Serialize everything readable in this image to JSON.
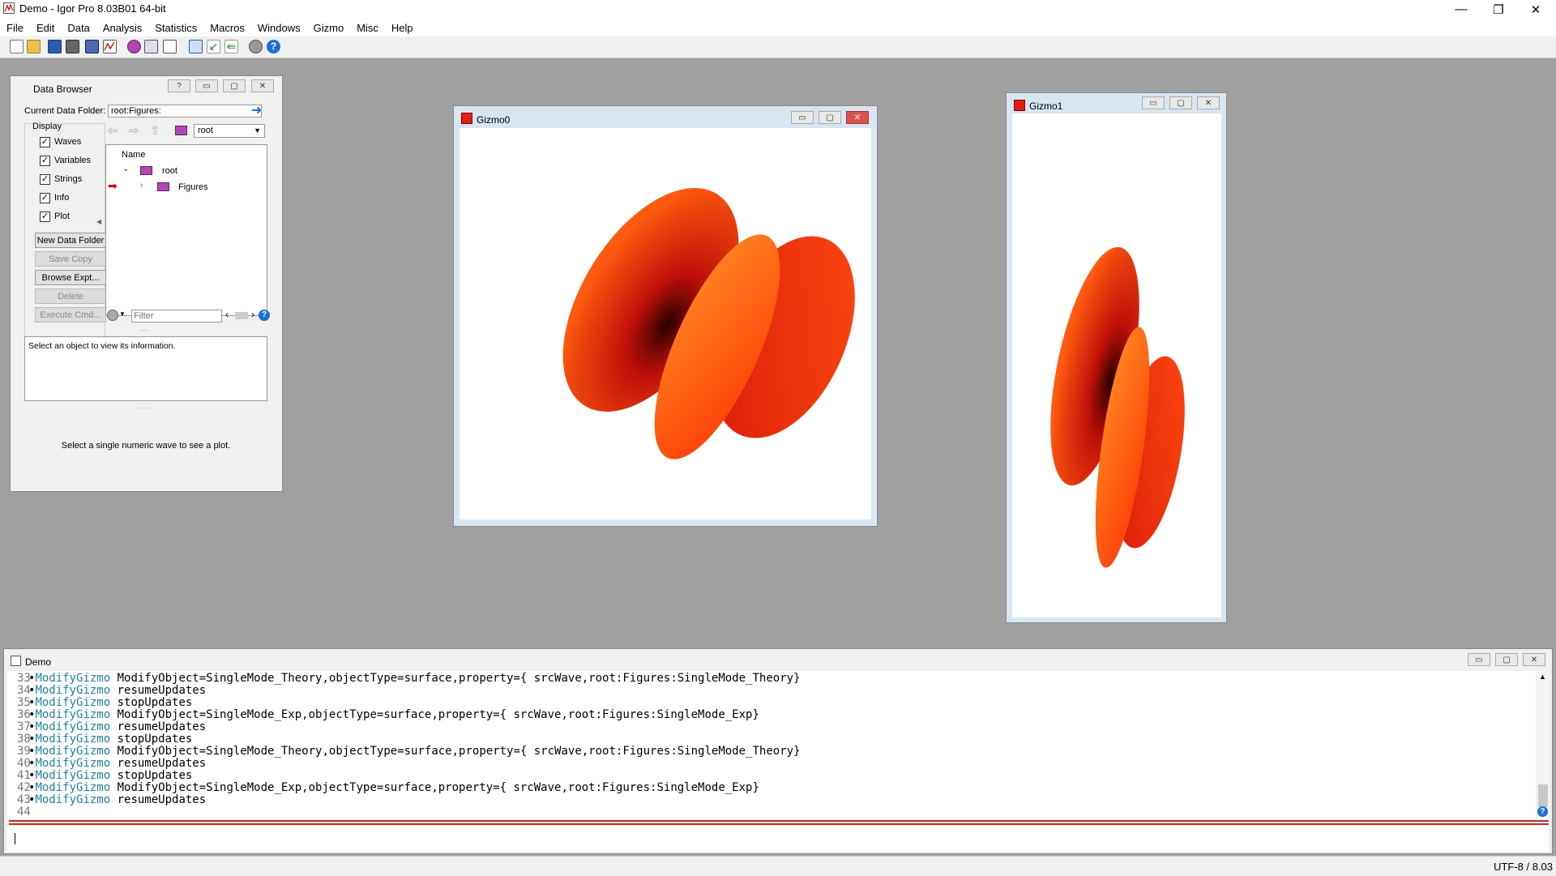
{
  "app": {
    "title": "Demo - Igor Pro 8.03B01 64-bit",
    "controls": {
      "minimize": "—",
      "restore": "❐",
      "close": "✕"
    }
  },
  "menu": [
    "File",
    "Edit",
    "Data",
    "Analysis",
    "Statistics",
    "Macros",
    "Windows",
    "Gizmo",
    "Misc",
    "Help"
  ],
  "toolbar": {
    "icons": [
      "new-file-icon",
      "open-folder-icon",
      "save-icon",
      "print-icon",
      "save-all-icon",
      "graph-icon",
      "gizmo-icon",
      "table-icon",
      "layout-icon",
      "export-icon",
      "import-icon",
      "load-icon",
      "settings-gear-icon",
      "help-icon"
    ]
  },
  "data_browser": {
    "title": "Data Browser",
    "controls": {
      "help": "?",
      "minimize": "▭",
      "restore": "▢",
      "close": "✕"
    },
    "current_folder_label": "Current Data Folder:",
    "current_folder_value": "root:Figures:",
    "display_label": "Display",
    "display_options": [
      {
        "label": "Waves",
        "checked": true
      },
      {
        "label": "Variables",
        "checked": true
      },
      {
        "label": "Strings",
        "checked": true
      },
      {
        "label": "Info",
        "checked": true
      },
      {
        "label": "Plot",
        "checked": true
      }
    ],
    "buttons": [
      {
        "label": "New Data Folder",
        "enabled": true
      },
      {
        "label": "Save Copy",
        "enabled": false
      },
      {
        "label": "Browse Expt...",
        "enabled": true
      },
      {
        "label": "Delete",
        "enabled": false
      },
      {
        "label": "Execute Cmd...",
        "enabled": false
      }
    ],
    "folder_select": "root",
    "tree_header": "Name",
    "tree": [
      {
        "label": "root",
        "expanded": true
      },
      {
        "label": "Figures",
        "expanded": false,
        "current": true
      }
    ],
    "filter_placeholder": "Filter",
    "info_text": "Select an object to view its information.",
    "plot_text": "Select a single numeric wave to see a plot."
  },
  "gizmo0": {
    "title": "Gizmo0",
    "controls": {
      "minimize": "▭",
      "restore": "▢",
      "close": "✕"
    }
  },
  "gizmo1": {
    "title": "Gizmo1",
    "controls": {
      "minimize": "▭",
      "restore": "▢",
      "close": "✕"
    }
  },
  "surface_colors": {
    "dark": "#3a0000",
    "mid": "#e02010",
    "light": "#ff7a10"
  },
  "console": {
    "title": "Demo",
    "controls": {
      "minimize": "▭",
      "restore": "▢",
      "close": "✕"
    },
    "lines": [
      {
        "num": "33",
        "cmd": "ModifyGizmo",
        "args": "ModifyObject=SingleMode_Theory,objectType=surface,property={ srcWave,root:Figures:SingleMode_Theory}"
      },
      {
        "num": "34",
        "cmd": "ModifyGizmo",
        "args": "resumeUpdates"
      },
      {
        "num": "35",
        "cmd": "ModifyGizmo",
        "args": "stopUpdates"
      },
      {
        "num": "36",
        "cmd": "ModifyGizmo",
        "args": "ModifyObject=SingleMode_Exp,objectType=surface,property={ srcWave,root:Figures:SingleMode_Exp}"
      },
      {
        "num": "37",
        "cmd": "ModifyGizmo",
        "args": "resumeUpdates"
      },
      {
        "num": "38",
        "cmd": "ModifyGizmo",
        "args": "stopUpdates"
      },
      {
        "num": "39",
        "cmd": "ModifyGizmo",
        "args": "ModifyObject=SingleMode_Theory,objectType=surface,property={ srcWave,root:Figures:SingleMode_Theory}"
      },
      {
        "num": "40",
        "cmd": "ModifyGizmo",
        "args": "resumeUpdates"
      },
      {
        "num": "41",
        "cmd": "ModifyGizmo",
        "args": "stopUpdates"
      },
      {
        "num": "42",
        "cmd": "ModifyGizmo",
        "args": "ModifyObject=SingleMode_Exp,objectType=surface,property={ srcWave,root:Figures:SingleMode_Exp}"
      },
      {
        "num": "43",
        "cmd": "ModifyGizmo",
        "args": "resumeUpdates"
      },
      {
        "num": "44",
        "cmd": "",
        "args": ""
      }
    ],
    "scroll_up": "▲",
    "scroll_down": "▼",
    "help": "?"
  },
  "status_bar": {
    "text": "UTF-8 / 8.03"
  }
}
